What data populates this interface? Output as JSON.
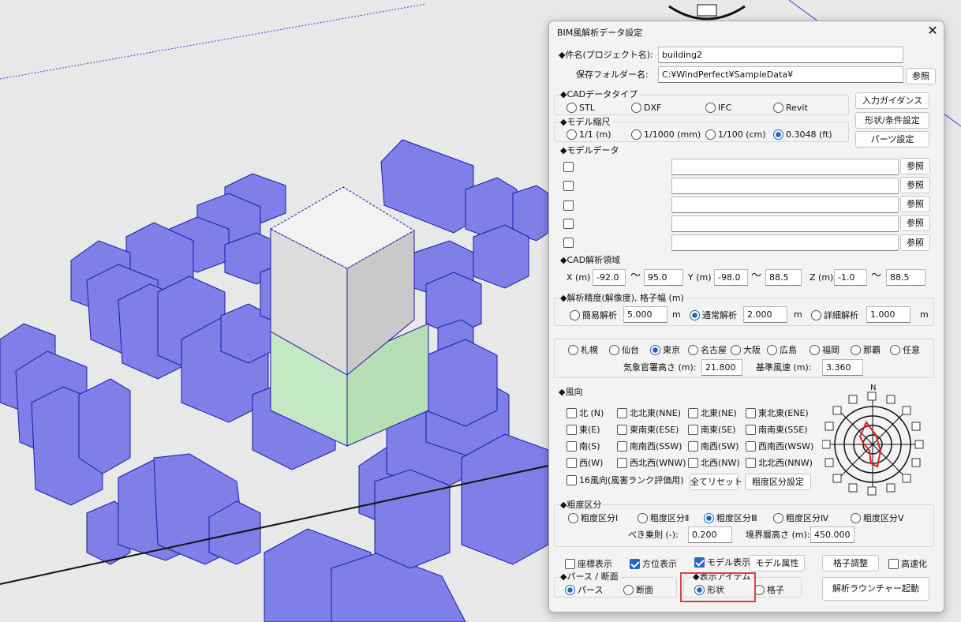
{
  "dialog": {
    "title": "BIM風解析データ設定",
    "close_label": "✕"
  },
  "project": {
    "name_label": "◆件名(プロジェクト名):",
    "name_value": "building2",
    "folder_label": "保存フォルダー名:",
    "folder_value": "C:¥WindPerfect¥SampleData¥",
    "browse_label": "参照"
  },
  "side_buttons": {
    "input_guidance": "入力ガイダンス",
    "shape_conditions": "形状/条件設定",
    "parts_settings": "パーツ設定"
  },
  "cad_type": {
    "label": "◆CADデータタイプ",
    "options": [
      "STL",
      "DXF",
      "IFC",
      "Revit"
    ],
    "selected": ""
  },
  "scale": {
    "label": "◆モデル縮尺",
    "options": [
      "1/1 (m)",
      "1/1000 (mm)",
      "1/100 (cm)",
      "0.3048 (ft)"
    ],
    "selected": "0.3048 (ft)"
  },
  "model_data": {
    "label": "◆モデルデータ",
    "rows": [
      {
        "checked": false,
        "value": ""
      },
      {
        "checked": false,
        "value": ""
      },
      {
        "checked": false,
        "value": ""
      },
      {
        "checked": false,
        "value": ""
      },
      {
        "checked": false,
        "value": ""
      }
    ],
    "browse_label": "参照"
  },
  "domain": {
    "label": "◆CAD解析領域",
    "x_label": "X (m)",
    "x_min": "-92.0",
    "x_max": "95.0",
    "y_label": "Y (m)",
    "y_min": "-98.0",
    "y_max": "88.5",
    "z_label": "Z (m)",
    "z_min": "-1.0",
    "z_max": "88.5",
    "tilde": "～"
  },
  "precision": {
    "label": "◆解析精度(解像度), 格子幅 (m)",
    "simple": {
      "label": "簡易解析",
      "value": "5.000"
    },
    "normal": {
      "label": "通常解析",
      "value": "2.000"
    },
    "detail": {
      "label": "詳細解析",
      "value": "1.000"
    },
    "unit": "m",
    "selected": "通常解析"
  },
  "cities": {
    "options": [
      "札幌",
      "仙台",
      "東京",
      "名古屋",
      "大阪",
      "広島",
      "福岡",
      "那覇",
      "任意"
    ],
    "selected": "東京",
    "station_height_label": "気象官署高さ (m):",
    "station_height_value": "21.800",
    "base_wind_label": "基準風速 (m):",
    "base_wind_value": "3.360"
  },
  "wind_direction": {
    "label": "◆風向",
    "directions": [
      "北 (N)",
      "北北東(NNE)",
      "北東(NE)",
      "東北東(ENE)",
      "東(E)",
      "東南東(ESE)",
      "南東(SE)",
      "南南東(SSE)",
      "南(S)",
      "南南西(SSW)",
      "南西(SW)",
      "西南西(WSW)",
      "西(W)",
      "西北西(WNW)",
      "北西(NW)",
      "北北西(NNW)"
    ],
    "sixteen_label": "16風向(風害ランク評価用)",
    "reset_label": "全てリセット",
    "roughness_button": "粗度区分設定",
    "north_label": "N"
  },
  "roughness": {
    "label": "◆粗度区分",
    "options": [
      "粗度区分Ⅰ",
      "粗度区分Ⅱ",
      "粗度区分Ⅲ",
      "粗度区分Ⅳ",
      "粗度区分Ⅴ"
    ],
    "selected": "粗度区分Ⅲ",
    "exponent_label": "べき乗則 (-):",
    "exponent_value": "0.200",
    "boundary_label": "境界層高さ (m):",
    "boundary_value": "450.000"
  },
  "bottom": {
    "coord_display": {
      "label": "座標表示",
      "checked": false
    },
    "orientation_display": {
      "label": "方位表示",
      "checked": true
    },
    "model_display": {
      "label": "モデル表示",
      "checked": true
    },
    "model_attr_label": "モデル属性",
    "grid_adjust_label": "格子調整",
    "speedup": {
      "label": "高速化",
      "checked": false
    },
    "view_label": "◆パース / 断面",
    "view_options": [
      "パース",
      "断面"
    ],
    "view_selected": "パース",
    "display_item_label": "◆表示アイテム",
    "display_options": [
      "形状",
      "格子"
    ],
    "display_selected": "形状",
    "launcher_label": "解析ラウンチャー起動"
  },
  "colors": {
    "building_fill": "#7f7fe8",
    "building_edge": "#1a1aa8",
    "tower_grey": "#e0e0e0",
    "tower_green": "#bfe3bf",
    "highlight": "#e04040",
    "radio_accent": "#1e64c8"
  }
}
